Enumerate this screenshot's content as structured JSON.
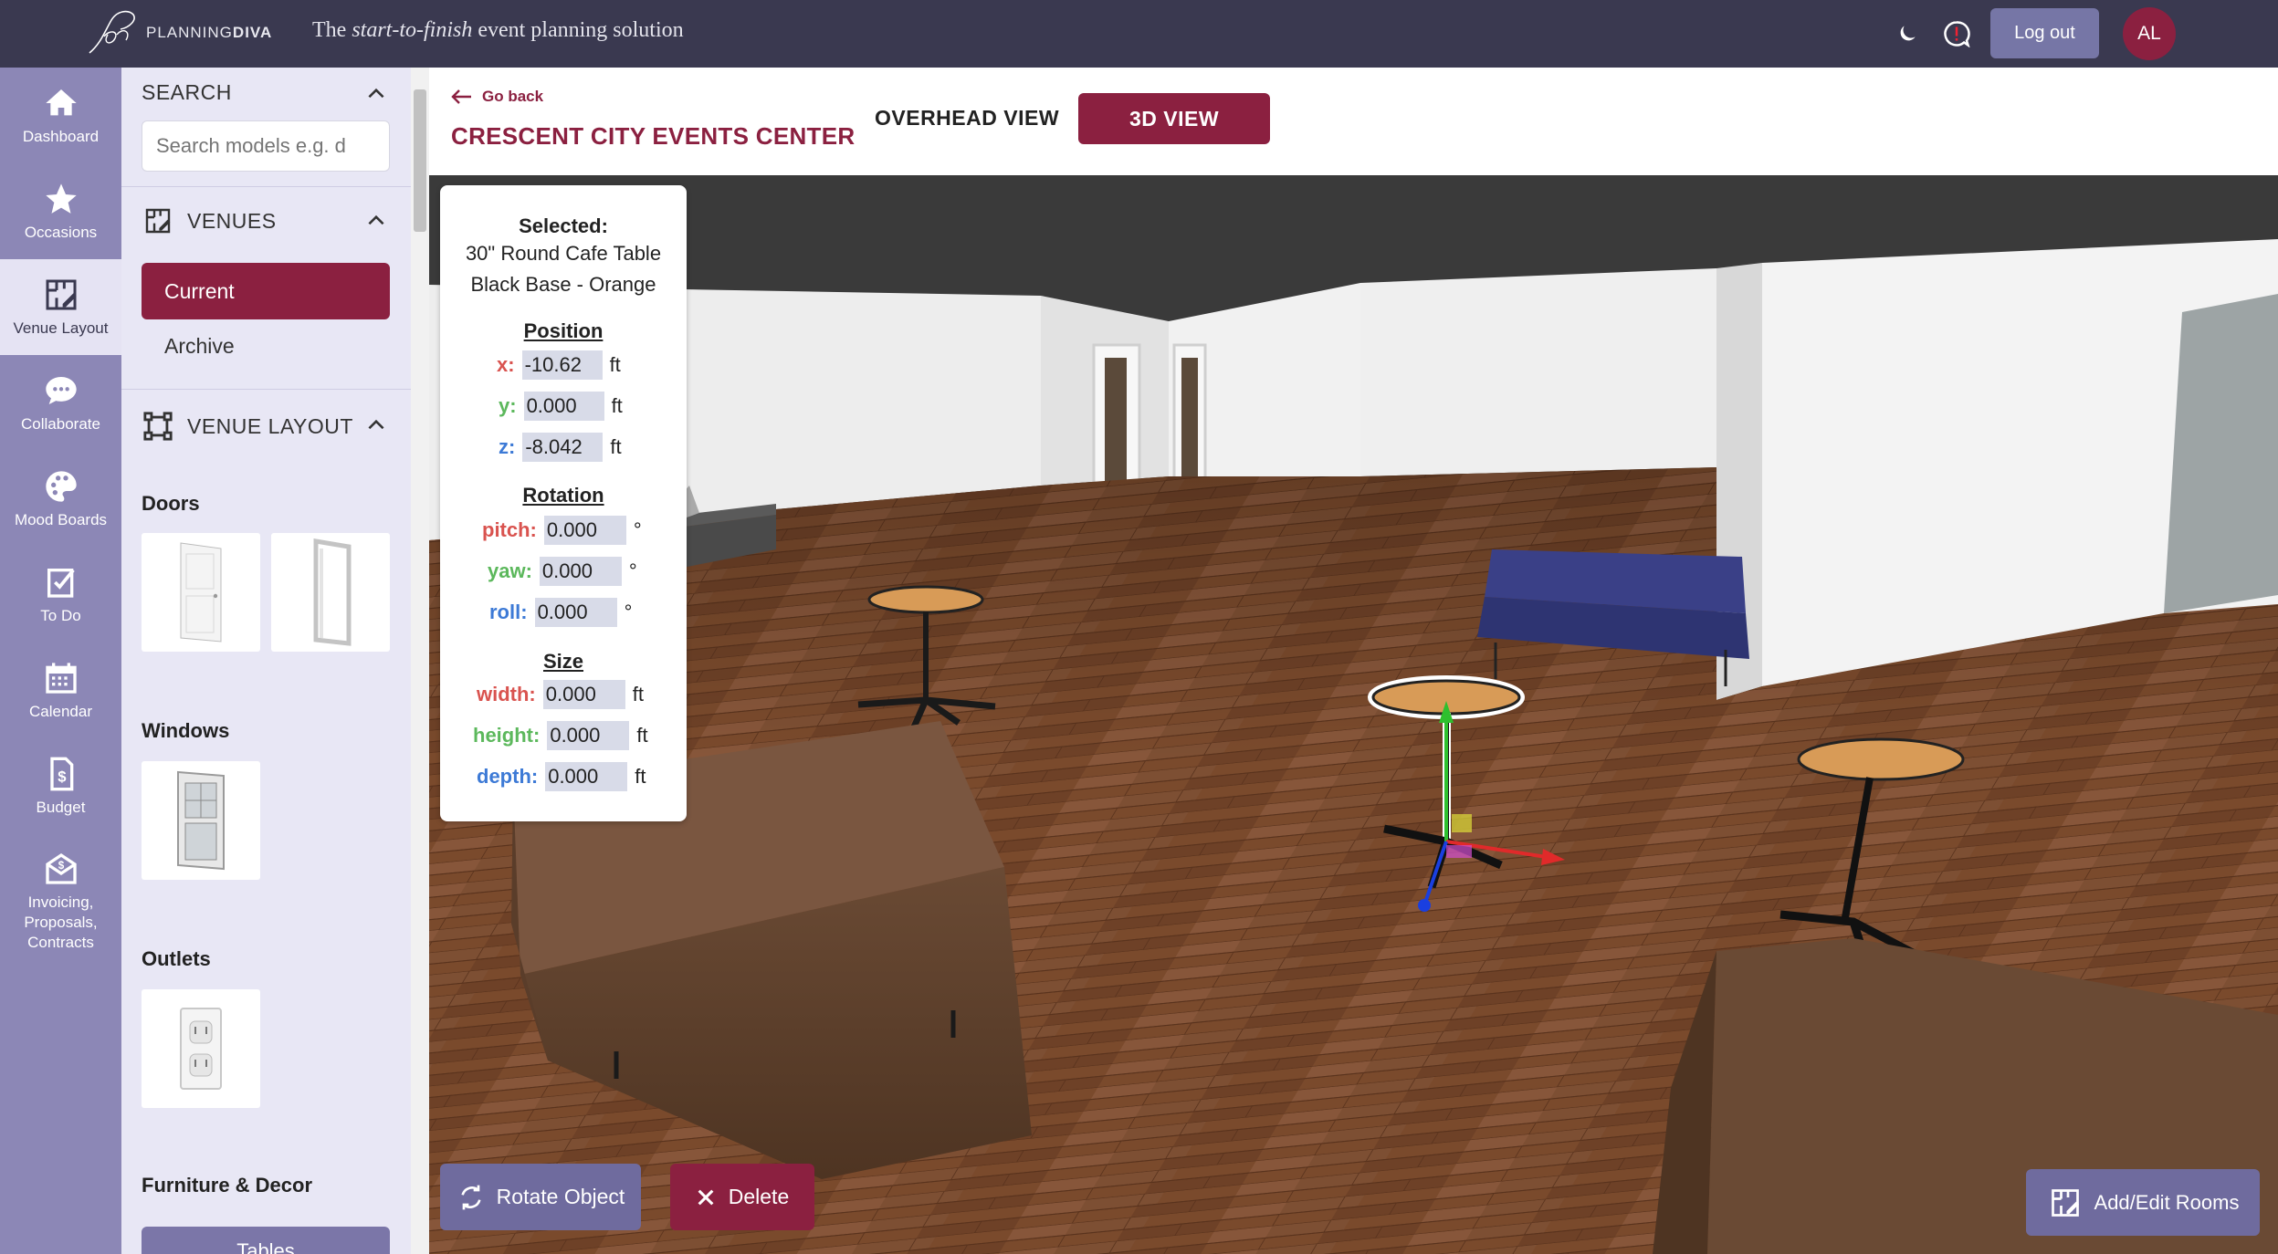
{
  "app": {
    "logo_text_plain": "PLANNING",
    "logo_text_bold": "DIVA",
    "tagline_prefix": "The ",
    "tagline_italic": "start-to-finish",
    "tagline_suffix": " event planning solution",
    "logout_label": "Log out",
    "avatar_initials": "AL"
  },
  "nav": {
    "items": [
      {
        "label": "Dashboard",
        "icon": "home-icon"
      },
      {
        "label": "Occasions",
        "icon": "star-icon"
      },
      {
        "label": "Venue Layout",
        "icon": "venue-layout-icon",
        "active": true
      },
      {
        "label": "Collaborate",
        "icon": "chat-icon"
      },
      {
        "label": "Mood Boards",
        "icon": "palette-icon"
      },
      {
        "label": "To Do",
        "icon": "checklist-icon"
      },
      {
        "label": "Calendar",
        "icon": "calendar-icon"
      },
      {
        "label": "Budget",
        "icon": "budget-icon"
      },
      {
        "label": "Invoicing,\nProposals,\nContracts",
        "icon": "invoice-icon"
      }
    ]
  },
  "panel": {
    "search_title": "SEARCH",
    "search_placeholder": "Search models e.g. d",
    "venues_title": "VENUES",
    "current_label": "Current",
    "archive_label": "Archive",
    "venue_layout_title": "VENUE LAYOUT",
    "categories": {
      "doors": "Doors",
      "windows": "Windows",
      "outlets": "Outlets",
      "furniture": "Furniture & Decor",
      "tables_tab": "Tables"
    }
  },
  "header": {
    "go_back": "Go back",
    "venue_name": "CRESCENT CITY EVENTS CENTER",
    "overhead_view": "OVERHEAD VIEW",
    "view_3d": "3D VIEW"
  },
  "selected": {
    "heading": "Selected:",
    "name_line1": "30\" Round Cafe Table",
    "name_line2": "Black Base - Orange",
    "position_title": "Position",
    "x_label": "x:",
    "x_value": "-10.62",
    "y_label": "y:",
    "y_value": "0.000",
    "z_label": "z:",
    "z_value": "-8.042",
    "unit_ft": "ft",
    "rotation_title": "Rotation",
    "pitch_label": "pitch:",
    "pitch_value": "0.000",
    "yaw_label": "yaw:",
    "yaw_value": "0.000",
    "roll_label": "roll:",
    "roll_value": "0.000",
    "unit_deg": "°",
    "size_title": "Size",
    "width_label": "width:",
    "width_value": "0.000",
    "height_label": "height:",
    "height_value": "0.000",
    "depth_label": "depth:",
    "depth_value": "0.000"
  },
  "actions": {
    "rotate": "Rotate Object",
    "delete": "Delete",
    "add_edit_rooms": "Add/Edit Rooms"
  },
  "colors": {
    "topbar": "#3a3950",
    "nav": "#8c87b6",
    "accent": "#8b2040",
    "panel": "#e8e7f5",
    "button_purple": "#6f6b9e"
  }
}
